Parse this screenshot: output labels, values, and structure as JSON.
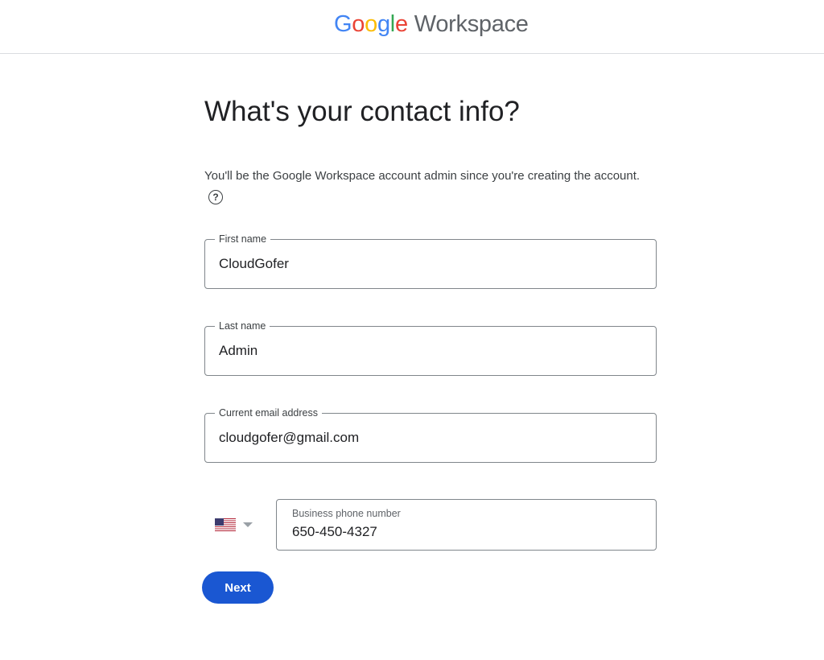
{
  "header": {
    "brand_google_letters": [
      "G",
      "o",
      "o",
      "g",
      "l",
      "e"
    ],
    "brand_product": "Workspace",
    "brand_colors": {
      "blue": "#4285F4",
      "red": "#EA4335",
      "yellow": "#FBBC05",
      "green": "#34A853",
      "product_gray": "#5f6368"
    }
  },
  "page": {
    "title": "What's your contact info?",
    "intro": "You'll be the Google Workspace account admin since you're creating the account.",
    "help_icon": "question-circle-icon"
  },
  "form": {
    "first_name": {
      "label": "First name",
      "value": "CloudGofer"
    },
    "last_name": {
      "label": "Last name",
      "value": "Admin"
    },
    "email": {
      "label": "Current email address",
      "value": "cloudgofer@gmail.com"
    },
    "phone": {
      "country_flag": "us-flag-icon",
      "label": "Business phone number",
      "value": "650-450-4327"
    }
  },
  "actions": {
    "next_label": "Next",
    "next_color": "#1a57d2"
  }
}
